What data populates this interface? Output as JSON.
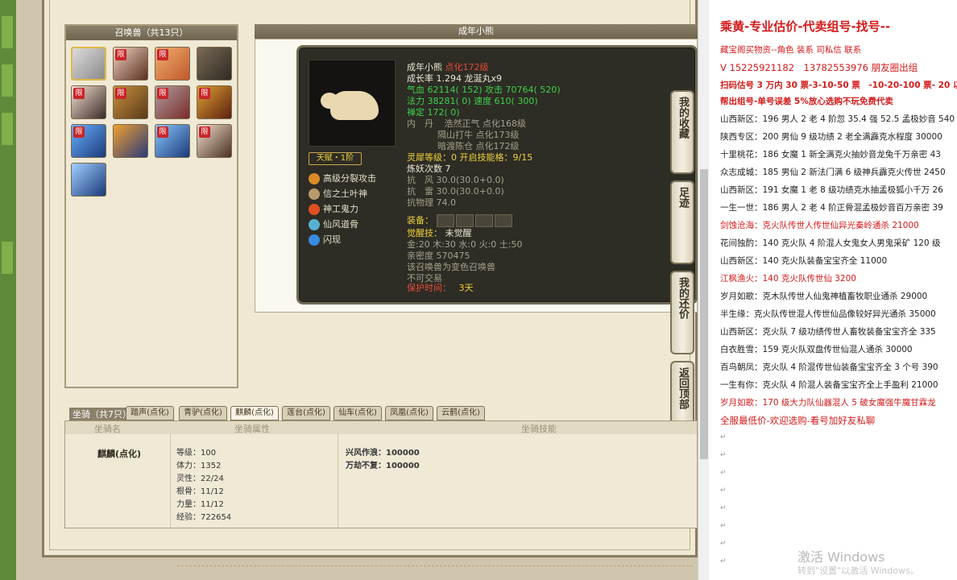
{
  "summon_panel": {
    "title": "召唤兽（共13只）",
    "limit_badge": "限"
  },
  "pet_info": {
    "header": "成年小熊",
    "name": "成年小熊",
    "name_level": "点化172级",
    "growth": "成长率 1.294 龙涎丸x9",
    "hp": "气血 62114( 152) 攻击 70764( 520)",
    "mp": "法力 38281( 0) 速度 610( 300)",
    "zen": "禅定 172( 0)",
    "dan_label": "内　丹",
    "dan1": "浩然正气 点化168级",
    "dan2": "隔山打牛 点化173级",
    "dan3": "暗渡陈仓 点化172级",
    "talent": "天赋・1阶",
    "skills": [
      "高级分裂攻击",
      "信之土叶神",
      "神工鬼力",
      "仙风道骨",
      "闪现"
    ],
    "spirit": "灵犀等级：0 开启技能格：9/15",
    "refine": "炼妖次数 7",
    "resist1": "抗　风 30.0(30.0+0.0)",
    "resist2": "抗　雷 30.0(30.0+0.0)",
    "resist3": "抗物理 74.0",
    "equip_label": "装备：",
    "awaken_label": "觉醒技：",
    "awaken_value": "未觉醒",
    "elements": "金:20 木:30 水:0 火:0 土:50",
    "intimacy": "亲密度 570475",
    "note1": "该召唤兽为变色召唤兽",
    "note2": "不可交易",
    "protect_label": "保护时间：",
    "protect_value": "3天"
  },
  "side_buttons": [
    {
      "label": "我的收藏"
    },
    {
      "label": "足迹"
    },
    {
      "label": "我的还价"
    },
    {
      "label": "返回顶部"
    }
  ],
  "mount": {
    "label": "坐骑（共7只）",
    "tabs": [
      "踏声(点化)",
      "青驴(点化)",
      "麒麟(点化)",
      "莲台(点化)",
      "仙车(点化)",
      "凤凰(点化)",
      "云鹤(点化)"
    ],
    "col_name": "坐骑名",
    "col_attr": "坐骑属性",
    "col_skill": "坐骑技能",
    "name": "麒麟(点化)",
    "attrs": [
      "等级：100",
      "体力：1352",
      "灵性：22/24",
      "根骨：11/12",
      "力量：11/12",
      "经验：722654"
    ],
    "skills": [
      "兴风作浪：100000",
      "万劫不复：100000"
    ]
  },
  "doc": {
    "title": "乘黄-专业估价-代卖组号-找号--",
    "line1": "藏宝阁买物资--角色 装系 司私信 联系",
    "line2": "V 15225921182　13782553976 朋友圈出组",
    "line3": "扫码估号 3 万内 30 票-3-10-50 票　-10-20-100 票- 20 以上",
    "line4": "帮出组号-单号误差 5%放心选购不玩免费代卖",
    "entries": [
      {
        "text": "山西新区：196 男人 2 老 4 阶忽 35.4 强 52.5 孟极妙音 540",
        "red": false
      },
      {
        "text": "陕西专区：200 男仙 9 级功绩 2 老全满霹克水程度 30000",
        "red": false
      },
      {
        "text": "十里桃花：186 女魔 1 新全满克火抽妙音龙兔千万亲密 43",
        "red": false
      },
      {
        "text": "众志成城：185 男仙 2 新法门满 6 级神兵霹克火传世 2450",
        "red": false
      },
      {
        "text": "山西新区：191 女魔 1 老 8 级功绩克水抽孟极狐小千万 26",
        "red": false
      },
      {
        "text": "一生一世：186 男人 2 老 4 阶正骨混孟极妙音百万亲密 39",
        "red": false
      },
      {
        "text": "剑蚀沧海：克火队传世人传世仙异光秦岭通杀 21000",
        "red": true
      },
      {
        "text": "花间独酌：140 克火队 4 阶混人女鬼女人男鬼采矿 120 级",
        "red": false
      },
      {
        "text": "山西新区：140 克火队装备宝宝齐全 11000",
        "red": false
      },
      {
        "text": "江枫渔火：140 克火队传世仙 3200",
        "red": true
      },
      {
        "text": "岁月如歌：克木队传世人仙鬼神植畜牧职业通杀 29000",
        "red": false
      },
      {
        "text": "半生缘：克火队传世混人传世仙品像较好异光通杀 35000",
        "red": false
      },
      {
        "text": "山西新区：克火队 7 级功绩传世人畜牧装备宝宝齐全 335",
        "red": false
      },
      {
        "text": "白衣胜雪：159 克火队双盘传世仙混人通杀 30000",
        "red": false
      },
      {
        "text": "百鸟朝凤：克火队 4 阶混传世仙装备宝宝齐全 3 个号 390",
        "red": false
      },
      {
        "text": "一生有你：克火队 4 阶混人装备宝宝齐全上手盈利 21000",
        "red": false
      },
      {
        "text": "岁月如歌：170 级大力队仙器混人 5 破女魔强牛魔甘霖龙",
        "red": true
      }
    ],
    "footer": "全服最低价-欢迎选购-看号加好友私聊",
    "para_mark": "↵",
    "watermark1": "激活 Windows",
    "watermark2": "转到\"设置\"以激活 Windows。"
  }
}
